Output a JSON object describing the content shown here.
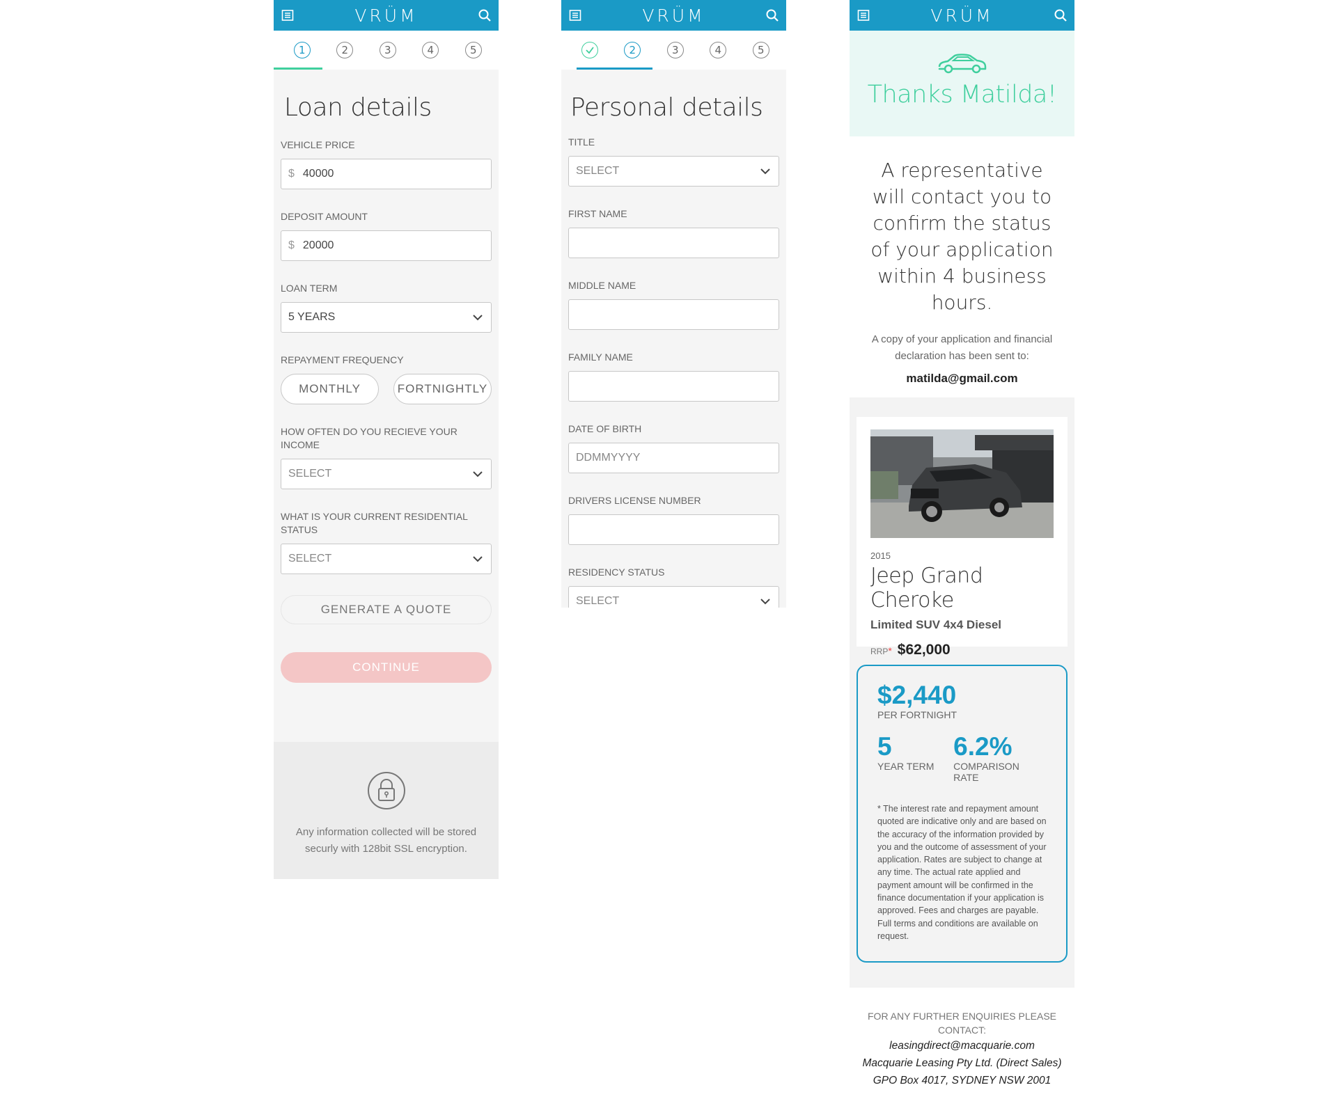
{
  "app": {
    "logo": "VRÜM"
  },
  "steps": [
    "1",
    "2",
    "3",
    "4",
    "5"
  ],
  "loan": {
    "title": "Loan details",
    "vehicle_price": {
      "label": "VEHICLE PRICE",
      "currency": "$",
      "value": "40000"
    },
    "deposit": {
      "label": "DEPOSIT AMOUNT",
      "currency": "$",
      "value": "20000"
    },
    "loan_term": {
      "label": "LOAN TERM",
      "value": "5 YEARS"
    },
    "repayment": {
      "label": "REPAYMENT FREQUENCY",
      "options": [
        "MONTHLY",
        "FORTNIGHTLY"
      ]
    },
    "income": {
      "label": "HOW OFTEN DO YOU RECIEVE YOUR INCOME",
      "value": "SELECT"
    },
    "residential": {
      "label": "WHAT IS YOUR CURRENT RESIDENTIAL STATUS",
      "value": "SELECT"
    },
    "generate_label": "GENERATE A QUOTE",
    "continue_label": "CONTINUE",
    "secure_text": "Any information collected will be stored securly with 128bit SSL encryption."
  },
  "personal": {
    "title": "Personal details",
    "title_field": {
      "label": "TITLE",
      "value": "SELECT"
    },
    "first_name": {
      "label": "FIRST NAME",
      "value": ""
    },
    "middle_name": {
      "label": "MIDDLE NAME",
      "value": ""
    },
    "family_name": {
      "label": "FAMILY NAME",
      "value": ""
    },
    "dob": {
      "label": "DATE OF BIRTH",
      "placeholder": "DDMMYYYY"
    },
    "license": {
      "label": "DRIVERS LICENSE NUMBER",
      "value": ""
    },
    "residency": {
      "label": "RESIDENCY STATUS",
      "value": "SELECT"
    }
  },
  "confirm": {
    "thanks": "Thanks Matilda!",
    "message": "A representative will contact you to confirm the status of your application within 4 business hours.",
    "copy_text": "A copy of your application and financial declaration has been sent to:",
    "email": "matilda@gmail.com",
    "vehicle": {
      "year": "2015",
      "model": "Jeep Grand Cheroke",
      "variant": "Limited SUV 4x4 Diesel",
      "rrp_label": "RRP",
      "rrp_star": "*",
      "price": "$62,000"
    },
    "quote": {
      "amount": "$2,440",
      "amount_label": "PER FORTNIGHT",
      "term": "5",
      "term_label": "YEAR TERM",
      "rate": "6.2%",
      "rate_label": "COMPARISON RATE",
      "disclaimer": "* The interest rate and repayment amount quoted are indicative only and are based on the accuracy of the information provided by you and the outcome of assessment of your application. Rates are subject to change at any time. The actual rate applied and payment amount will be confirmed in the finance documentation if your application is approved. Fees and charges are payable. Full terms and conditions are available on request."
    },
    "footer": {
      "heading": "FOR ANY FURTHER ENQUIRIES PLEASE CONTACT:",
      "lines": [
        "leasingdirect@macquarie.com",
        "Macquarie Leasing Pty Ltd. (Direct Sales)",
        "GPO Box 4017, SYDNEY NSW 2001"
      ]
    }
  },
  "colors": {
    "brand": "#1a9ac6",
    "accent_green": "#3fcf9d",
    "continue_disabled": "#f4c6c6"
  }
}
